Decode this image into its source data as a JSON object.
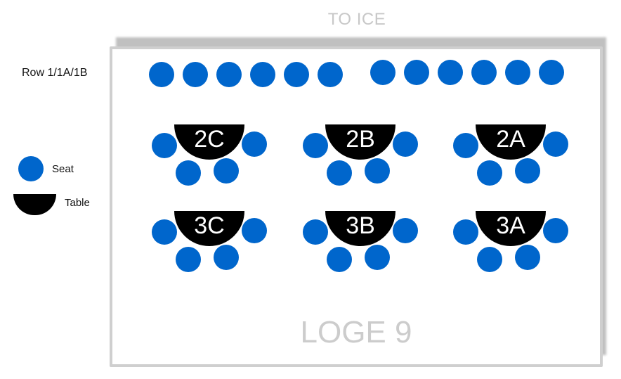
{
  "header": {
    "direction_label": "TO ICE"
  },
  "room": {
    "name": "LOGE 9"
  },
  "rows": [
    {
      "label": "Row 1/1A/1B",
      "seat_count": 12
    }
  ],
  "legend": {
    "seat_label": "Seat",
    "table_label": "Table"
  },
  "tables": [
    {
      "id": "2C",
      "seats": 4
    },
    {
      "id": "2B",
      "seats": 4
    },
    {
      "id": "2A",
      "seats": 4
    },
    {
      "id": "3C",
      "seats": 4
    },
    {
      "id": "3B",
      "seats": 4
    },
    {
      "id": "3A",
      "seats": 4
    }
  ],
  "colors": {
    "seat": "#0066cc",
    "table": "#000000",
    "wall": "#cfcfcf",
    "label_muted": "#c8c8c8"
  }
}
